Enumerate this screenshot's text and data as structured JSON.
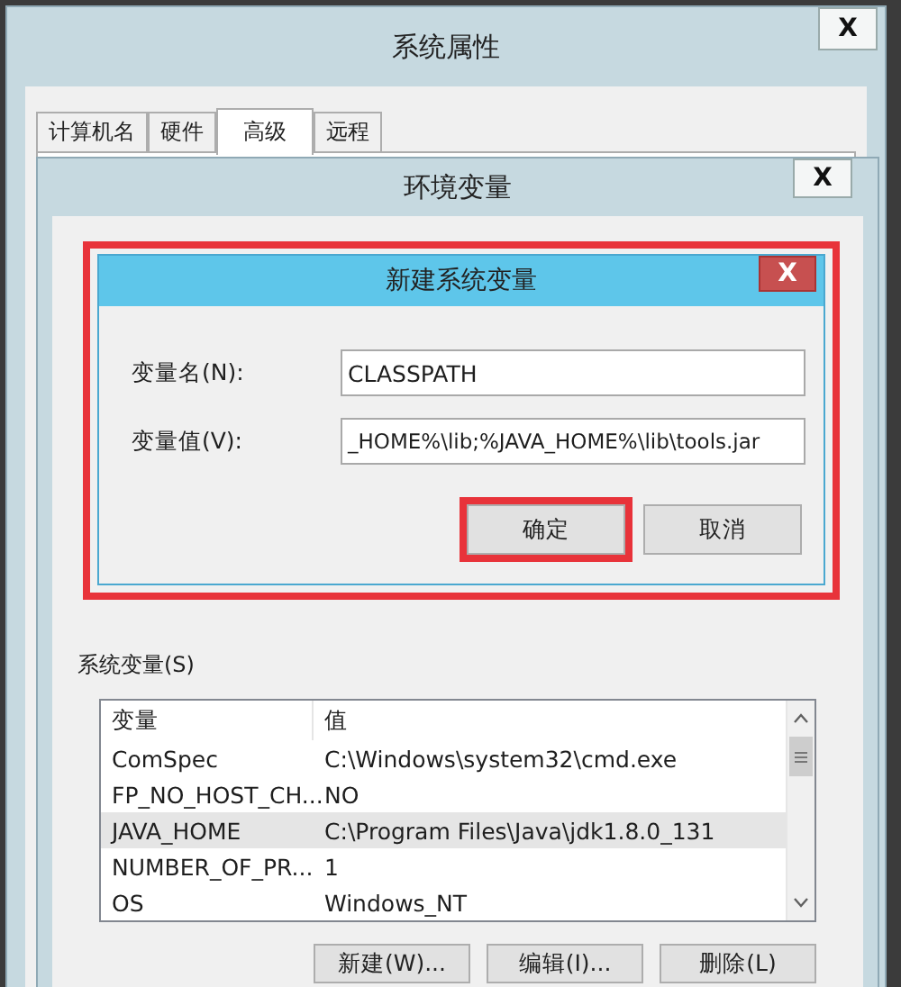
{
  "system_properties": {
    "title": "系统属性",
    "close": "X",
    "tabs": [
      {
        "label": "计算机名",
        "selected": false
      },
      {
        "label": "硬件",
        "selected": false
      },
      {
        "label": "高级",
        "selected": true
      },
      {
        "label": "远程",
        "selected": false
      }
    ]
  },
  "environment_variables": {
    "title": "环境变量",
    "close": "X",
    "new_variable_dialog": {
      "title": "新建系统变量",
      "close": "X",
      "highlighted": true,
      "fields": [
        {
          "label": "变量名(N):",
          "value": "CLASSPATH"
        },
        {
          "label": "变量值(V):",
          "value": "_HOME%\\lib;%JAVA_HOME%\\lib\\tools.jar"
        }
      ],
      "buttons": [
        {
          "label": "确定",
          "highlighted": true
        },
        {
          "label": "取消",
          "highlighted": false
        }
      ]
    },
    "system_variables": {
      "label": "系统变量(S)",
      "columns": [
        "变量",
        "值"
      ],
      "rows": [
        {
          "name": "ComSpec",
          "value": "C:\\Windows\\system32\\cmd.exe",
          "selected": false
        },
        {
          "name": "FP_NO_HOST_CH...",
          "value": "NO",
          "selected": false
        },
        {
          "name": "JAVA_HOME",
          "value": "C:\\Program Files\\Java\\jdk1.8.0_131",
          "selected": true
        },
        {
          "name": "NUMBER_OF_PR...",
          "value": "1",
          "selected": false
        },
        {
          "name": "OS",
          "value": "Windows_NT",
          "selected": false
        }
      ],
      "buttons": [
        "新建(W)...",
        "编辑(I)...",
        "删除(L)"
      ]
    }
  }
}
